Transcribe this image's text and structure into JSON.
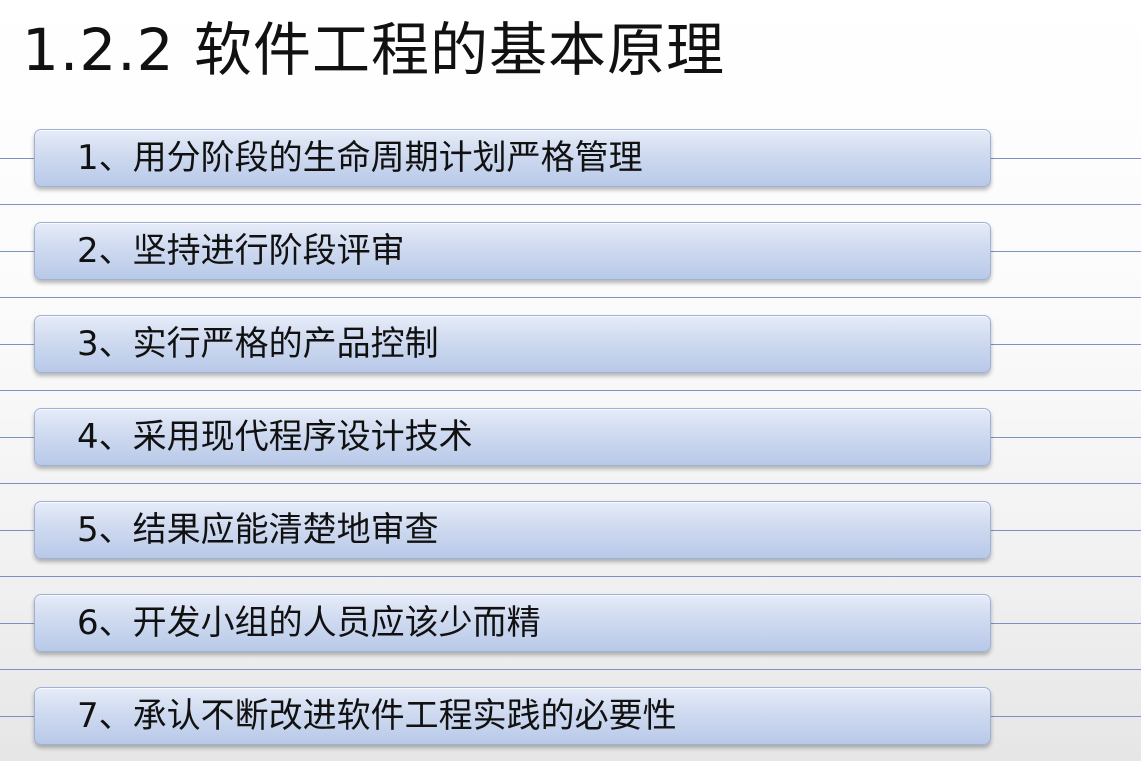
{
  "slide": {
    "title": "1.2.2 软件工程的基本原理",
    "items": [
      {
        "label": "1、用分阶段的生命周期计划严格管理"
      },
      {
        "label": "2、坚持进行阶段评审"
      },
      {
        "label": "3、实行严格的产品控制"
      },
      {
        "label": "4、采用现代程序设计技术"
      },
      {
        "label": "5、结果应能清楚地审查"
      },
      {
        "label": "6、开发小组的人员应该少而精"
      },
      {
        "label": "7、承认不断改进软件工程实践的必要性"
      }
    ]
  }
}
